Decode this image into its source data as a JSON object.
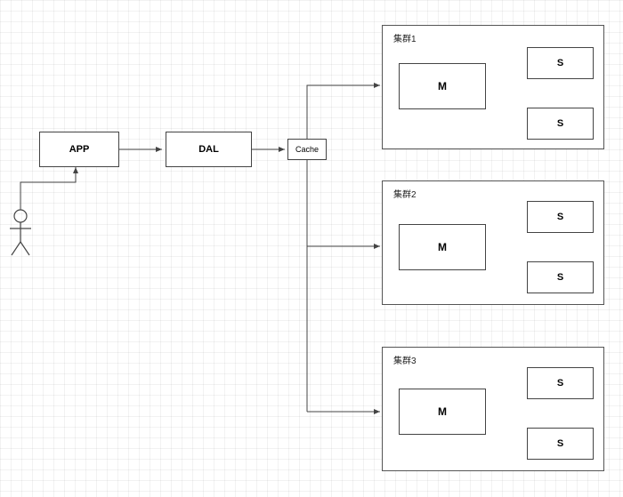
{
  "nodes": {
    "app": "APP",
    "dal": "DAL",
    "cache": "Cache"
  },
  "clusters": [
    {
      "title": "集群1",
      "master": "M",
      "slaves": [
        "S",
        "S"
      ]
    },
    {
      "title": "集群2",
      "master": "M",
      "slaves": [
        "S",
        "S"
      ]
    },
    {
      "title": "集群3",
      "master": "M",
      "slaves": [
        "S",
        "S"
      ]
    }
  ]
}
